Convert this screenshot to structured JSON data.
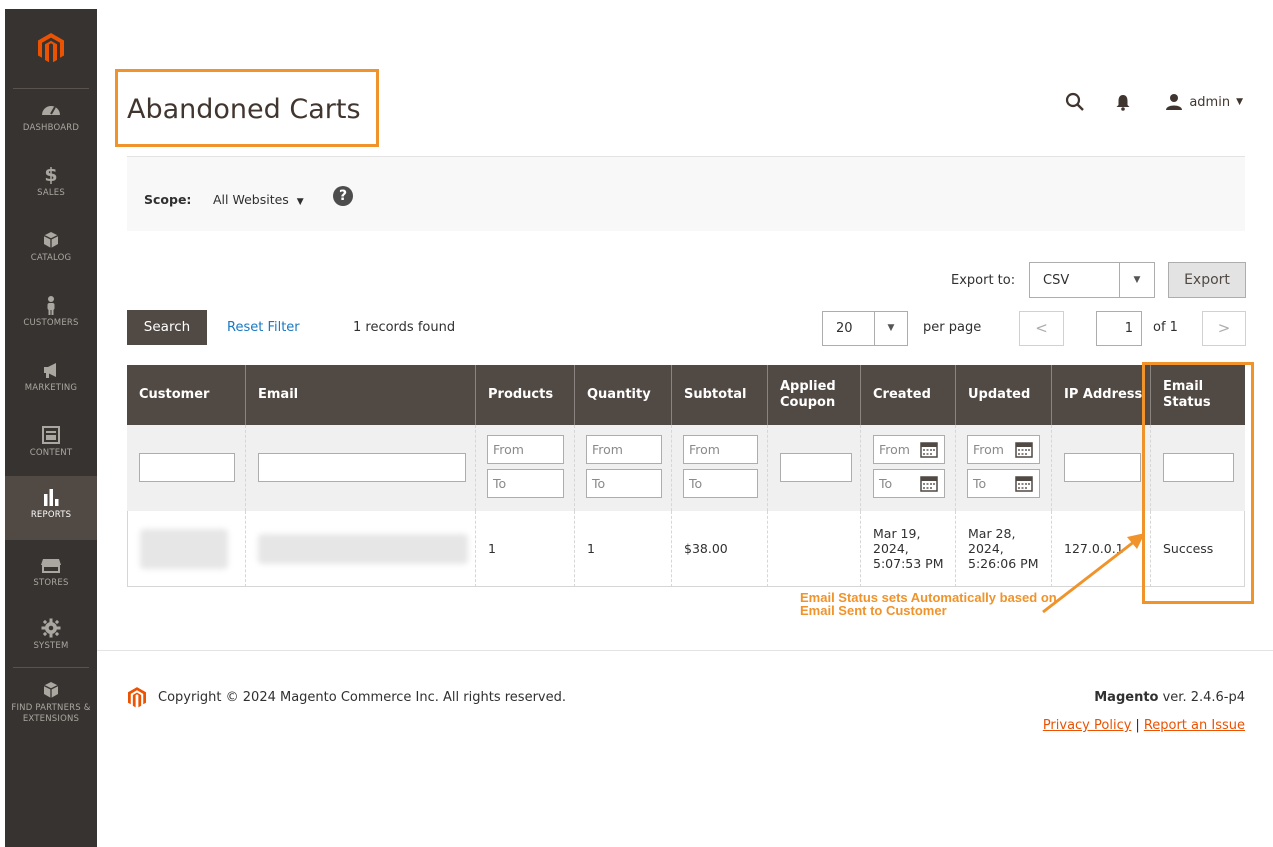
{
  "sidebar": {
    "items": [
      {
        "label": "DASHBOARD",
        "icon": "dashboard-icon"
      },
      {
        "label": "SALES",
        "icon": "dollar-icon"
      },
      {
        "label": "CATALOG",
        "icon": "box-icon"
      },
      {
        "label": "CUSTOMERS",
        "icon": "person-icon"
      },
      {
        "label": "MARKETING",
        "icon": "megaphone-icon"
      },
      {
        "label": "CONTENT",
        "icon": "content-icon"
      },
      {
        "label": "REPORTS",
        "icon": "bar-chart-icon",
        "active": true
      },
      {
        "label": "STORES",
        "icon": "store-icon"
      },
      {
        "label": "SYSTEM",
        "icon": "gear-icon"
      },
      {
        "label": "FIND PARTNERS & EXTENSIONS",
        "icon": "extensions-icon"
      }
    ]
  },
  "header": {
    "title": "Abandoned Carts",
    "user": "admin"
  },
  "scope": {
    "label": "Scope:",
    "value": "All Websites",
    "help": "?"
  },
  "export": {
    "label": "Export to:",
    "format": "CSV",
    "button": "Export"
  },
  "toolbar": {
    "search": "Search",
    "reset": "Reset Filter",
    "records": "1 records found",
    "per_page_value": "20",
    "per_page_label": "per page",
    "page": "1",
    "of": "of 1"
  },
  "grid": {
    "columns": [
      "Customer",
      "Email",
      "Products",
      "Quantity",
      "Subtotal",
      "Applied Coupon",
      "Created",
      "Updated",
      "IP Address",
      "Email Status"
    ],
    "filter_from": "From",
    "filter_to": "To",
    "row": {
      "products": "1",
      "quantity": "1",
      "subtotal": "$38.00",
      "created_line1": "Mar 19,",
      "created_line2": "2024,",
      "created_line3": "5:07:53 PM",
      "updated_line1": "Mar 28,",
      "updated_line2": "2024,",
      "updated_line3": "5:26:06 PM",
      "ip": "127.0.0.1",
      "email_status": "Success"
    }
  },
  "annotation": {
    "text": "Email Status sets Automatically based on Email Sent to Customer",
    "color": "#f0932b"
  },
  "footer": {
    "copyright": "Copyright © 2024 Magento Commerce Inc. All rights reserved.",
    "brand": "Magento",
    "version": " ver. 2.4.6-p4",
    "privacy": "Privacy Policy",
    "separator": "|",
    "report": "Report an Issue"
  },
  "colors": {
    "sidebar": "#373330",
    "accent": "#eb5202",
    "highlight": "#f0932b",
    "header_row": "#514943"
  }
}
